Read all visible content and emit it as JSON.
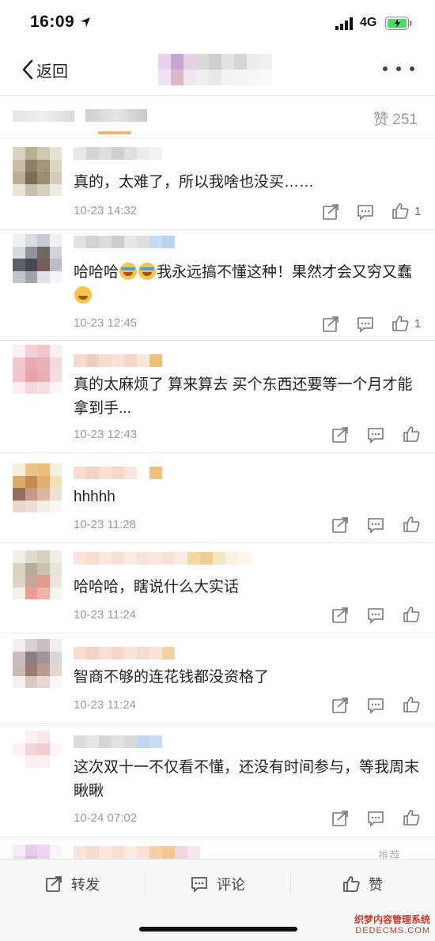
{
  "status_bar": {
    "time": "16:09",
    "network": "4G"
  },
  "nav": {
    "back_label": "返回"
  },
  "tabs": {
    "likes_label": "赞 251"
  },
  "comments": [
    {
      "text": "真的，太难了，所以我啥也没买……",
      "time": "10-23 14:32",
      "likes": "1"
    },
    {
      "text_a": "哈哈哈",
      "text_b": "我永远搞不懂这种！果然才会又穷又蠢",
      "time": "10-23 12:45",
      "likes": "1"
    },
    {
      "text": "真的太麻烦了 算来算去 买个东西还要等一个月才能拿到手...",
      "time": "10-23 12:43",
      "likes": ""
    },
    {
      "text": "hhhhh",
      "time": "10-23 11:28",
      "likes": ""
    },
    {
      "text": "哈哈哈，瞎说什么大实话",
      "time": "10-23 11:24",
      "likes": ""
    },
    {
      "text": "智商不够的连花钱都没资格了",
      "time": "10-23 11:24",
      "likes": ""
    },
    {
      "text": "这次双十一不仅看不懂，还没有时间参与，等我周末瞅瞅",
      "time": "10-24 07:02",
      "likes": ""
    }
  ],
  "recommend_label": "推荐",
  "bottom_bar": {
    "repost_label": "转发",
    "comment_label": "评论",
    "like_label": "赞"
  },
  "watermark": {
    "line1": "织梦内容管理系统",
    "line2": "DEDECMS.COM"
  },
  "icons": [
    "location-arrow-icon",
    "signal-icon",
    "battery-icon",
    "back-chevron-icon",
    "more-dots-icon",
    "repost-icon",
    "comment-icon",
    "thumb-up-icon",
    "laugh-cry-emoji",
    "sweat-emoji"
  ],
  "colors": {
    "accent_underline": "#f2b27a",
    "battery_green": "#4cd964",
    "text_gray": "#9a9a9a"
  }
}
